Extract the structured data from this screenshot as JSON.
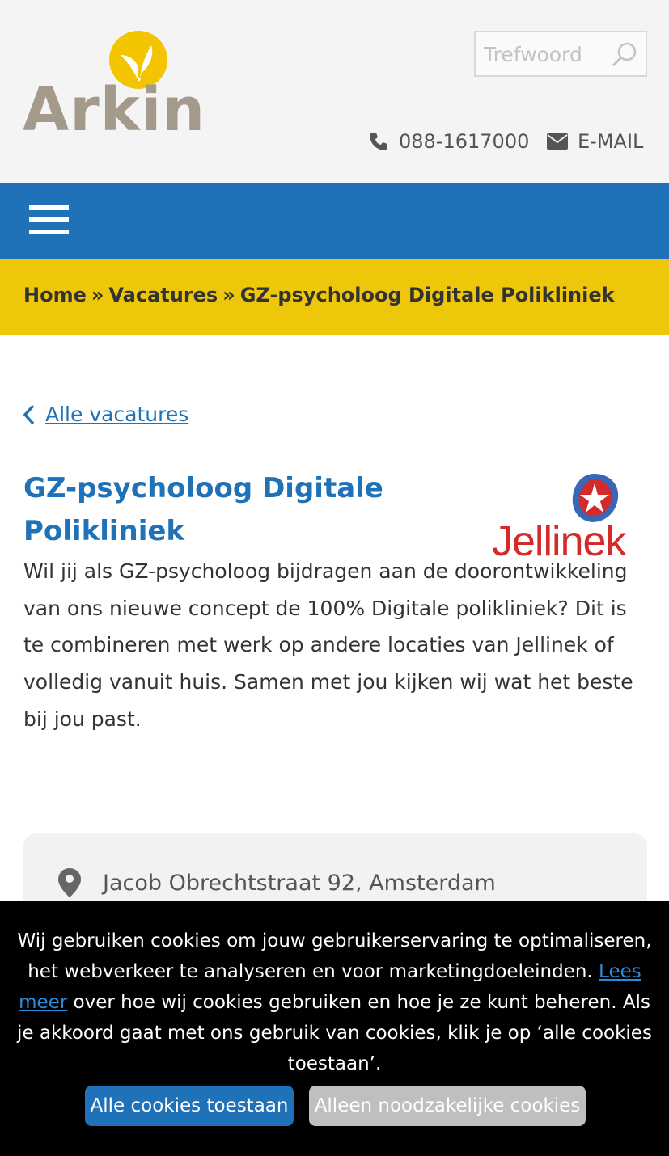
{
  "header": {
    "logo_text": "Arkin",
    "search": {
      "placeholder": "Trefwoord"
    },
    "phone": "088-1617000",
    "email_label": "E-MAIL"
  },
  "breadcrumb": {
    "items": [
      "Home",
      "Vacatures",
      "GZ-psycholoog Digitale Polikliniek"
    ],
    "separator": "»"
  },
  "back_link": "Alle vacatures",
  "job": {
    "title_line1": "GZ-psycholoog Digitale",
    "title_line2": "Polikliniek",
    "organisation_logo_text": "Jellinek",
    "intro": "Wil jij als GZ-psycholoog bijdragen aan de doorontwikkeling van ons nieuwe concept de 100% Digitale polikliniek? Dit is te combineren met werk op andere locaties van Jellinek of volledig vanuit huis. Samen met jou kijken wij wat het beste bij jou past.",
    "address": "Jacob Obrechtstraat 92, Amsterdam"
  },
  "cookie_banner": {
    "text_before_link": "Wij gebruiken cookies om jouw gebruikerservaring te optimaliseren, het webverkeer te analyseren en voor marketingdoeleinden.",
    "link": "Lees meer",
    "text_after_link": "over hoe wij cookies gebruiken en hoe je ze kunt beheren. Als je akkoord gaat met ons gebruik van cookies, klik je op ‘alle cookies toestaan’.",
    "accept_all": "Alle cookies toestaan",
    "necessary_only": "Alleen noodzakelijke cookies"
  },
  "colors": {
    "brand_blue": "#1f71b8",
    "brand_yellow": "#eec60a",
    "logo_grey": "#a49a8c",
    "jellinek_red": "#d42a2a"
  }
}
